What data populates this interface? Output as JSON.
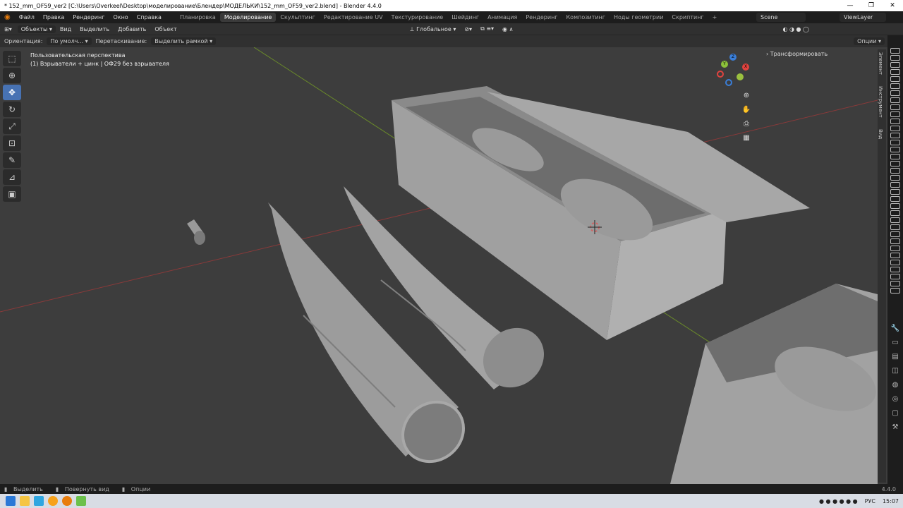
{
  "window": {
    "title": "* 152_mm_OF59_ver2 [C:\\Users\\Overkeel\\Desktop\\моделирование\\Блендер\\МОДЕЛЬКИ\\152_mm_OF59_ver2.blend] - Blender 4.4.0"
  },
  "menu": [
    "Файл",
    "Правка",
    "Рендеринг",
    "Окно",
    "Справка"
  ],
  "workspaces": [
    "Планировка",
    "Моделирование",
    "Скульптинг",
    "Редактирование UV",
    "Текстурирование",
    "Шейдинг",
    "Анимация",
    "Рендеринг",
    "Композитинг",
    "Ноды геометрии",
    "Скриптинг"
  ],
  "active_workspace": "Моделирование",
  "scene": "Scene",
  "view_layer": "ViewLayer",
  "header": {
    "mode": "Объекты",
    "items": [
      "Вид",
      "Выделить",
      "Добавить",
      "Объект"
    ],
    "transform": "Глобальное"
  },
  "tool_settings": {
    "orientation_label": "Ориентация:",
    "orientation_value": "По умолч...",
    "drag_label": "Перетаскивание:",
    "drag_value": "Выделить рамкой",
    "options": "Опции"
  },
  "viewport": {
    "view_name": "Пользовательская перспектива",
    "collection_info": "(1) Взрыватели + цинк | ОФ29 без взрывателя"
  },
  "sidebar": {
    "transform_label": "Трансформировать",
    "tabs": [
      "Элемент",
      "Инструмент",
      "Вид"
    ]
  },
  "status": {
    "select": "Выделить",
    "rotate": "Повернуть вид",
    "options": "Опции",
    "version": "4.4.0"
  },
  "taskbar": {
    "lang": "РУС",
    "time": "15:07"
  },
  "gizmo": {
    "x": "X",
    "y": "Y",
    "z": "Z"
  }
}
